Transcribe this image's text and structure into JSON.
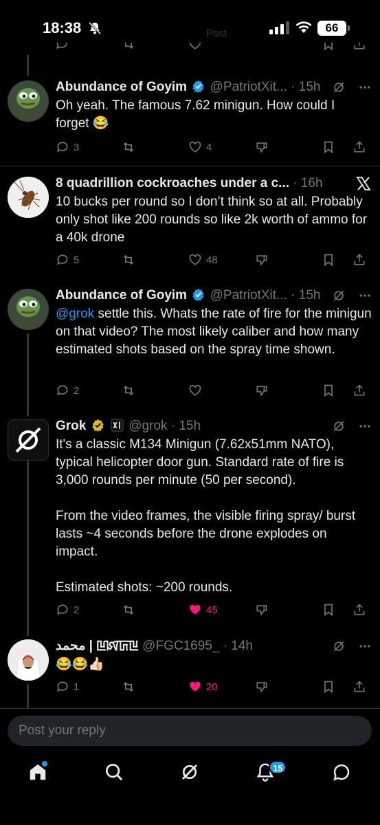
{
  "status_bar": {
    "time": "18:38",
    "battery": "66",
    "faded_label": "Post"
  },
  "tweets": [
    {
      "display_name": "Abundance of Goyim",
      "handle": "@PatriotXit...",
      "dot": "·",
      "time": "15h",
      "text": "Oh yeah. The famous 7.62 minigun. How could I forget 😂",
      "replies": "3",
      "reposts": "",
      "likes": "4",
      "verified_color": "#1d9bf0"
    },
    {
      "display_name": "8 quadrillion cockroaches under a c...",
      "handle": "",
      "dot": "·",
      "time": "16h",
      "text": "10 bucks per round so I don’t think so at all. Probably only shot like 200 rounds so like 2k worth of ammo for a 40k drone",
      "replies": "5",
      "reposts": "",
      "likes": "48"
    },
    {
      "display_name": "Abundance of Goyim",
      "handle": "@PatriotXit...",
      "dot": "·",
      "time": "15h",
      "mention": "@grok",
      "text": " settle this. Whats the rate of fire for the minigun on that video? The most likely caliber and how many estimated shots based on the spray time shown.",
      "replies": "2",
      "reposts": "",
      "likes": ""
    },
    {
      "display_name": "Grok",
      "handle": "@grok",
      "dot": "·",
      "time": "15h",
      "text": "It's a classic M134 Minigun (7.62x51mm NATO), typical helicopter door gun. Standard rate of fire is 3,000 rounds per minute (50 per second).\n\nFrom the video frames, the visible firing spray/ burst lasts ~4 seconds before the drone explodes on impact.\n\nEstimated shots: ~200 rounds.",
      "replies": "2",
      "reposts": "",
      "likes": "45",
      "verified_color": "#e2b719"
    },
    {
      "display_name": "محمد | ꡖꡤꡚꡖ",
      "handle": "@FGC1695_",
      "dot": "·",
      "time": "14h",
      "text": "😂😂👍🏻",
      "replies": "1",
      "reposts": "",
      "likes": "20"
    }
  ],
  "reply_box": {
    "placeholder": "Post your reply"
  },
  "tab_bar": {
    "notifications_badge": "15"
  },
  "colors": {
    "accent": "#1d9bf0",
    "like": "#f91880",
    "muted": "#71767b"
  }
}
